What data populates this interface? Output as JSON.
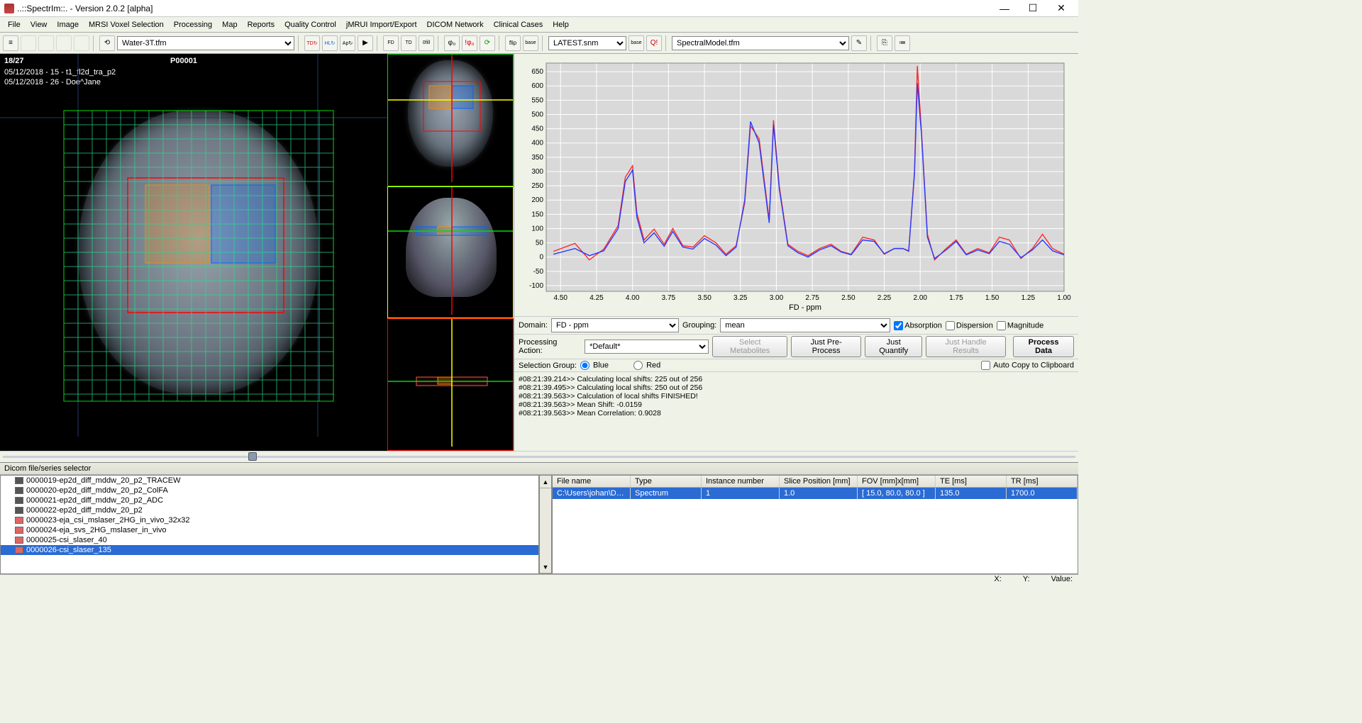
{
  "window": {
    "title": "..::SpectrIm::.   -   Version 2.0.2 [alpha]"
  },
  "menu": [
    "File",
    "View",
    "Image",
    "MRSI Voxel Selection",
    "Processing",
    "Map",
    "Reports",
    "Quality Control",
    "jMRUI Import/Export",
    "DICOM Network",
    "Clinical Cases",
    "Help"
  ],
  "toolbar": {
    "protocol_dropdown": "Water-3T.tfm",
    "snm_dropdown": "LATEST.snm",
    "model_dropdown": "SpectralModel.tfm"
  },
  "viewer": {
    "slice": "18/27",
    "patient_id": "P00001",
    "meta1": "05/12/2018 - 15 - t1_fl2d_tra_p2",
    "meta2": "05/12/2018 - 26 - Doe^Jane"
  },
  "chart_data": {
    "type": "line",
    "title": "",
    "xlabel": "FD - ppm",
    "ylabel": "",
    "x_reversed": true,
    "xlim": [
      1.0,
      4.6
    ],
    "ylim": [
      -120,
      680
    ],
    "y_ticks": [
      -100,
      -50,
      0,
      50,
      100,
      150,
      200,
      250,
      300,
      350,
      400,
      450,
      500,
      550,
      600,
      650
    ],
    "x_ticks": [
      4.5,
      4.25,
      4.0,
      3.75,
      3.5,
      3.25,
      3.0,
      2.75,
      2.5,
      2.25,
      2.0,
      1.75,
      1.5,
      1.25,
      1.0
    ],
    "series": [
      {
        "name": "Red",
        "color": "#ff2a2a",
        "x": [
          4.55,
          4.4,
          4.3,
          4.2,
          4.1,
          4.05,
          4.0,
          3.97,
          3.92,
          3.85,
          3.78,
          3.72,
          3.65,
          3.58,
          3.5,
          3.42,
          3.35,
          3.28,
          3.22,
          3.18,
          3.12,
          3.05,
          3.02,
          2.98,
          2.92,
          2.85,
          2.78,
          2.7,
          2.62,
          2.55,
          2.48,
          2.4,
          2.32,
          2.25,
          2.18,
          2.12,
          2.08,
          2.04,
          2.02,
          1.99,
          1.95,
          1.9,
          1.82,
          1.75,
          1.68,
          1.6,
          1.52,
          1.45,
          1.38,
          1.3,
          1.22,
          1.15,
          1.08,
          1.0
        ],
        "y": [
          20,
          48,
          -10,
          28,
          110,
          280,
          320,
          155,
          60,
          98,
          45,
          100,
          40,
          35,
          75,
          50,
          10,
          40,
          190,
          460,
          415,
          130,
          480,
          250,
          45,
          20,
          5,
          30,
          45,
          20,
          10,
          70,
          60,
          10,
          30,
          30,
          20,
          300,
          670,
          430,
          80,
          -10,
          30,
          60,
          10,
          30,
          15,
          70,
          60,
          -5,
          30,
          80,
          30,
          10
        ]
      },
      {
        "name": "Blue",
        "color": "#2a3bff",
        "x": [
          4.55,
          4.4,
          4.3,
          4.2,
          4.1,
          4.05,
          4.0,
          3.97,
          3.92,
          3.85,
          3.78,
          3.72,
          3.65,
          3.58,
          3.5,
          3.42,
          3.35,
          3.28,
          3.22,
          3.18,
          3.12,
          3.05,
          3.02,
          2.98,
          2.92,
          2.85,
          2.78,
          2.7,
          2.62,
          2.55,
          2.48,
          2.4,
          2.32,
          2.25,
          2.18,
          2.12,
          2.08,
          2.04,
          2.02,
          1.99,
          1.95,
          1.9,
          1.82,
          1.75,
          1.68,
          1.6,
          1.52,
          1.45,
          1.38,
          1.3,
          1.22,
          1.15,
          1.08,
          1.0
        ],
        "y": [
          10,
          30,
          5,
          22,
          100,
          265,
          305,
          140,
          50,
          85,
          38,
          90,
          35,
          28,
          65,
          42,
          5,
          35,
          200,
          475,
          400,
          120,
          465,
          240,
          40,
          15,
          0,
          25,
          40,
          18,
          8,
          60,
          55,
          12,
          30,
          30,
          22,
          290,
          610,
          420,
          70,
          -5,
          25,
          55,
          8,
          25,
          12,
          55,
          45,
          -2,
          25,
          60,
          22,
          8
        ]
      }
    ]
  },
  "domain": {
    "label": "Domain:",
    "value": "FD - ppm",
    "grouping_label": "Grouping:",
    "grouping_value": "mean",
    "absorption": "Absorption",
    "dispersion": "Dispersion",
    "magnitude": "Magnitude"
  },
  "processing": {
    "label": "Processing Action:",
    "value": "*Default*",
    "btn_metab": "Select Metabolites",
    "btn_pre": "Just Pre-Process",
    "btn_quant": "Just Quantify",
    "btn_handle": "Just Handle Results",
    "btn_process": "Process Data"
  },
  "selection_group": {
    "label": "Selection Group:",
    "opt_blue": "Blue",
    "opt_red": "Red",
    "autocopy": "Auto Copy to Clipboard"
  },
  "log": [
    "#08:21:39.214>> Calculating local shifts: 225 out of 256",
    "#08:21:39.495>> Calculating local shifts: 250 out of 256",
    "#08:21:39.563>> Calculation of local shifts FINISHED!",
    "#08:21:39.563>> Mean Shift: -0.0159",
    "#08:21:39.563>> Mean Correlation: 0.9028"
  ],
  "bottom": {
    "header": "Dicom file/series selector",
    "series": [
      {
        "sel": false,
        "icon": "#555",
        "label": "0000019-ep2d_diff_mddw_20_p2_TRACEW"
      },
      {
        "sel": false,
        "icon": "#555",
        "label": "0000020-ep2d_diff_mddw_20_p2_ColFA"
      },
      {
        "sel": false,
        "icon": "#555",
        "label": "0000021-ep2d_diff_mddw_20_p2_ADC"
      },
      {
        "sel": false,
        "icon": "#555",
        "label": "0000022-ep2d_diff_mddw_20_p2"
      },
      {
        "sel": false,
        "icon": "#d66",
        "label": "0000023-eja_csi_mslaser_2HG_in_vivo_32x32"
      },
      {
        "sel": false,
        "icon": "#d66",
        "label": "0000024-eja_svs_2HG_mslaser_in_vivo"
      },
      {
        "sel": false,
        "icon": "#d66",
        "label": "0000025-csi_slaser_40"
      },
      {
        "sel": true,
        "icon": "#d66",
        "label": "0000026-csi_slaser_135"
      }
    ],
    "columns": [
      "File name",
      "Type",
      "Instance number",
      "Slice Position [mm]",
      "FOV [mm]x[mm]",
      "TE [ms]",
      "TR [ms]"
    ],
    "rows": [
      {
        "sel": true,
        "cells": [
          "C:\\Users\\johan\\Doc…",
          "Spectrum",
          "1",
          "1.0",
          "[ 15.0, 80.0, 80.0 ]",
          "135.0",
          "1700.0"
        ]
      }
    ]
  },
  "status": {
    "x": "X:",
    "y": "Y:",
    "val": "Value:"
  }
}
